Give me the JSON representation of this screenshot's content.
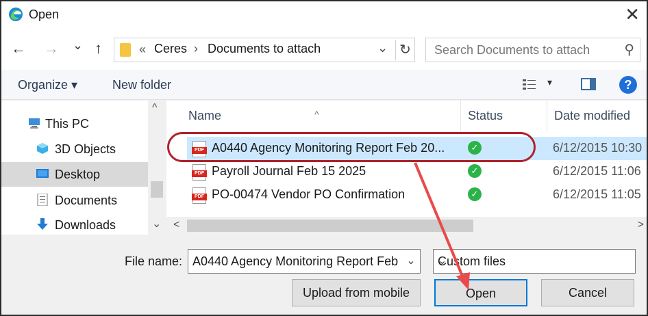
{
  "window": {
    "title": "Open",
    "close_glyph": "✕"
  },
  "nav": {
    "back": "←",
    "forward": "→",
    "recent": "⌄",
    "up": "↑",
    "address": {
      "prefix": "«",
      "crumbs": [
        "Ceres",
        "Documents to attach"
      ],
      "separator": "›",
      "dropdown": "⌄",
      "refresh": "↻"
    },
    "search": {
      "placeholder": "Search Documents to attach",
      "icon": "⚲"
    }
  },
  "toolbar": {
    "organize": "Organize ▾",
    "new_folder": "New folder",
    "view_dropdown": "▾",
    "help": "?"
  },
  "sidebar": {
    "items": [
      {
        "label": "This PC",
        "icon": "computer-icon"
      },
      {
        "label": "3D Objects",
        "icon": "cube-icon"
      },
      {
        "label": "Desktop",
        "icon": "desktop-icon",
        "selected": true
      },
      {
        "label": "Documents",
        "icon": "document-icon"
      },
      {
        "label": "Downloads",
        "icon": "download-icon"
      }
    ],
    "scroll_up": "^",
    "scroll_down": "⌄"
  },
  "filelist": {
    "columns": {
      "name": "Name",
      "status": "Status",
      "date": "Date modified",
      "sort_indicator": "^"
    },
    "files": [
      {
        "name": "A0440 Agency Monitoring Report Feb 20...",
        "status": "✓",
        "date": "6/12/2015 10:30",
        "selected": true
      },
      {
        "name": "Payroll Journal Feb 15 2025",
        "status": "✓",
        "date": "6/12/2015 11:06"
      },
      {
        "name": "PO-00474 Vendor PO Confirmation",
        "status": "✓",
        "date": "6/12/2015 11:05"
      }
    ],
    "pdf_label": "PDF",
    "scroll_left": "<",
    "scroll_right": ">"
  },
  "bottom": {
    "file_name_label": "File name:",
    "file_name_value": "A0440 Agency Monitoring Report Feb",
    "file_type": "Custom files",
    "dropdown": "⌄",
    "upload_button": "Upload from mobile",
    "open_button": "Open",
    "cancel_button": "Cancel"
  },
  "colors": {
    "highlight": "#b0222a",
    "arrow": "#e94a4a",
    "selection": "#cce8ff",
    "accent": "#0078d7"
  }
}
